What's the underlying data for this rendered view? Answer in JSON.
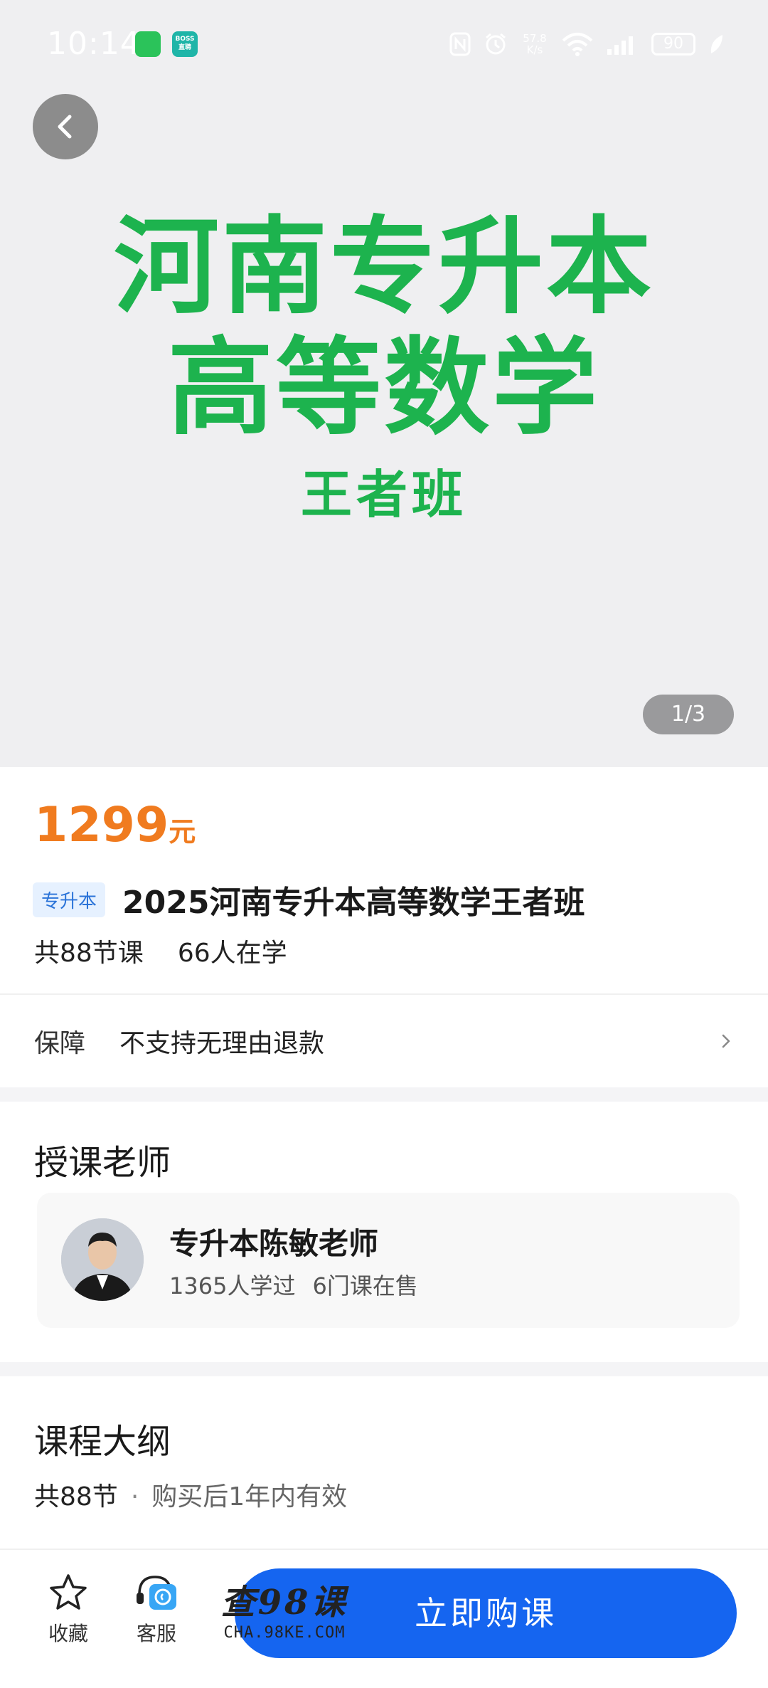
{
  "status_bar": {
    "time": "10:14",
    "boss_app_label": "BOSS直聘",
    "network_speed": "57.8 K/s",
    "battery": "90"
  },
  "hero": {
    "banner_line1": "河南专升本",
    "banner_line2": "高等数学",
    "banner_line3": "王者班",
    "image_counter": "1/3",
    "banner_color": "#1db34e"
  },
  "course": {
    "price": "1299",
    "price_unit": "元",
    "tag": "专升本",
    "title": "2025河南专升本高等数学王者班",
    "lessons": "共88节课",
    "learners": "66人在学"
  },
  "guarantee": {
    "label": "保障",
    "value": "不支持无理由退款"
  },
  "teacher_section": {
    "title": "授课老师",
    "name": "专升本陈敏老师",
    "students": "1365人学过",
    "courses": "6门课在售"
  },
  "syllabus": {
    "title": "课程大纲",
    "count": "共88节",
    "separator": "·",
    "validity": "购买后1年内有效"
  },
  "bottom_bar": {
    "favorite_label": "收藏",
    "service_label": "客服",
    "watermark_main": "查98课",
    "watermark_sub": "CHA.98KE.COM",
    "buy_label": "立即购课"
  },
  "colors": {
    "price": "#f07b1f",
    "accent_blue": "#1565f0",
    "tag_text": "#2a73d8"
  },
  "icons": [
    "back-icon",
    "favorite-star-icon",
    "customer-service-icon",
    "chevron-right-icon",
    "wifi-icon",
    "signal-icon",
    "nfc-icon",
    "alarm-icon",
    "wechat-icon",
    "boss-app-icon",
    "leaf-icon"
  ]
}
